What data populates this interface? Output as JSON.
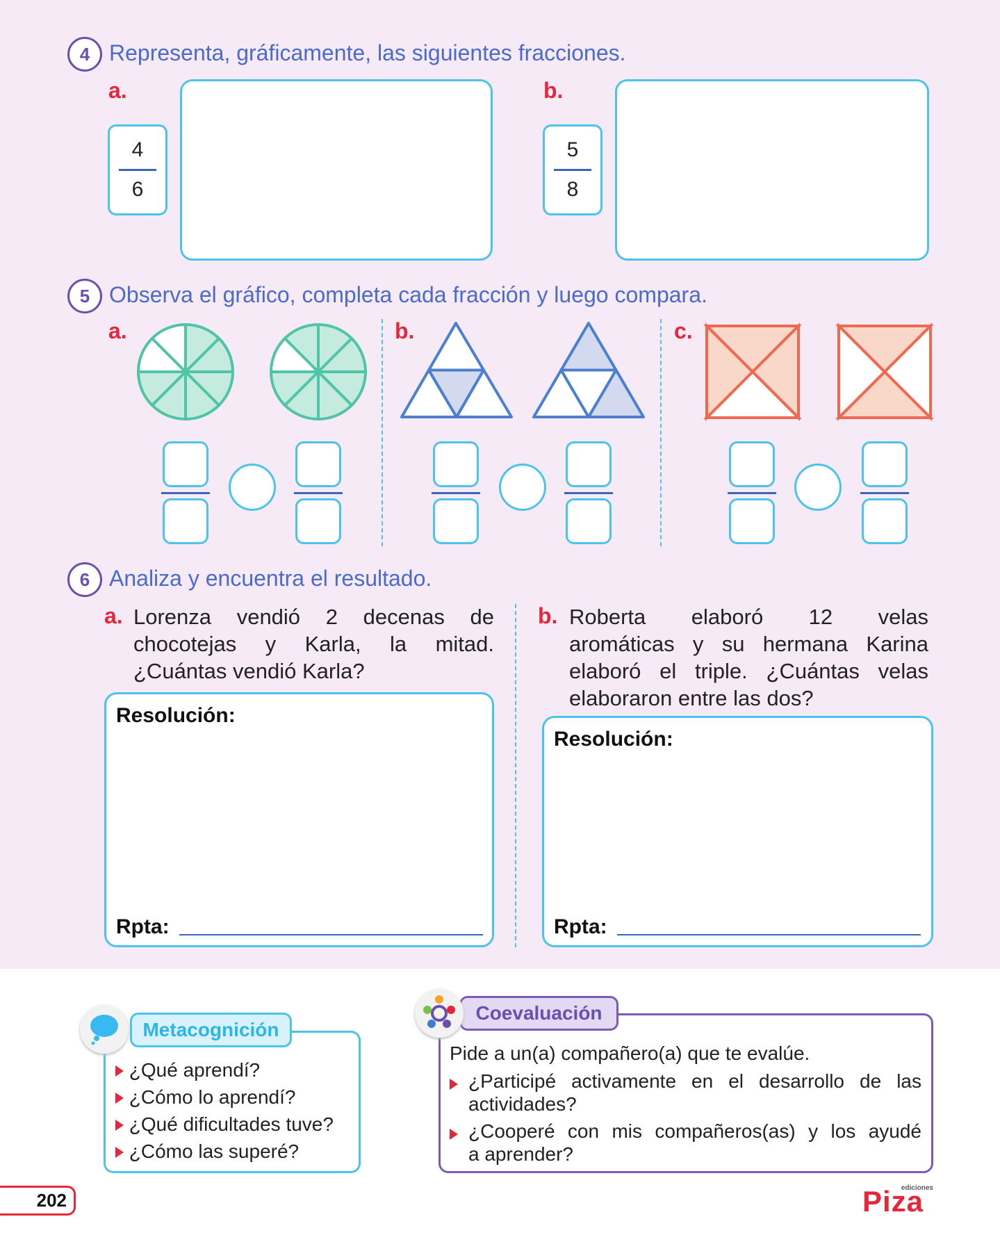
{
  "q4": {
    "number": "4",
    "title": "Representa, gráficamente, las siguientes fracciones.",
    "a": {
      "label": "a.",
      "numerator": "4",
      "denominator": "6"
    },
    "b": {
      "label": "b.",
      "numerator": "5",
      "denominator": "8"
    }
  },
  "q5": {
    "number": "5",
    "title": "Observa el gráfico, completa cada fracción y luego compara.",
    "a": {
      "label": "a.",
      "figure": "circle",
      "parts": 8,
      "shaded": [
        6,
        7
      ]
    },
    "b": {
      "label": "b.",
      "figure": "triangle",
      "parts": 4,
      "shaded": [
        1,
        2
      ]
    },
    "c": {
      "label": "c.",
      "figure": "square",
      "parts": 4,
      "shaded": [
        3,
        2
      ]
    }
  },
  "q6": {
    "number": "6",
    "title": "Analiza y encuentra el resultado.",
    "a": {
      "label": "a.",
      "lines": [
        "Lorenza vendió 2 decenas de",
        "chocotejas y Karla, la mitad.",
        "¿Cuántas vendió Karla?"
      ],
      "resolution": "Resolución:",
      "answer": "Rpta:"
    },
    "b": {
      "label": "b.",
      "lines": [
        "Roberta elaboró 12 velas",
        "aromáticas y su hermana Karina",
        "elaboró el triple. ¿Cuántas velas",
        "elaboraron entre las dos?"
      ],
      "resolution": "Resolución:",
      "answer": "Rpta:"
    }
  },
  "meta": {
    "title": "Metacognición",
    "items": [
      "¿Qué aprendí?",
      "¿Cómo lo aprendí?",
      "¿Qué dificultades tuve?",
      "¿Cómo las superé?"
    ]
  },
  "coev": {
    "title": "Coevaluación",
    "intro": "Pide a un(a) compañero(a) que te evalúe.",
    "items": [
      [
        "¿Participé activamente en el desarrollo de las",
        "actividades?"
      ],
      [
        "¿Cooperé con mis compañeros(as) y los ayudé",
        "a aprender?"
      ]
    ]
  },
  "footer": {
    "page": "202",
    "logo": "Piza",
    "logo_small": "ediciones"
  },
  "colors": {
    "accent_blue": "#4cc3ea",
    "title_blue": "#4a6bc9",
    "label_red": "#e5273a",
    "purple": "#6a4fb0"
  }
}
